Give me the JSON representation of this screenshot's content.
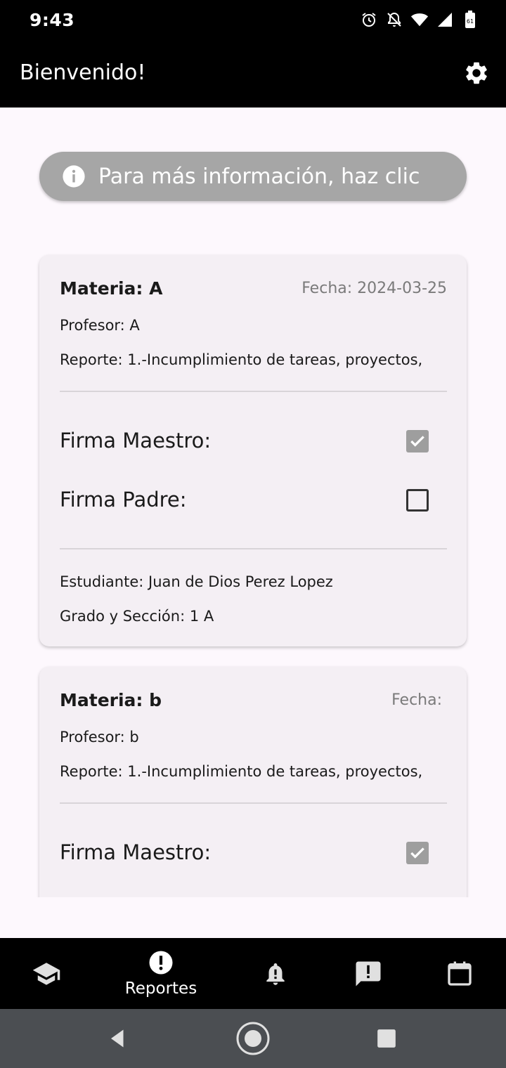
{
  "status_bar": {
    "time": "9:43",
    "icons": [
      "alarm-icon",
      "notifications-off-icon",
      "wifi-icon",
      "signal-icon",
      "battery-icon"
    ]
  },
  "app_bar": {
    "title": "Bienvenido!",
    "settings_icon": "gear-icon"
  },
  "info_banner": {
    "text": "Para más información, haz clic",
    "icon": "info-icon"
  },
  "reports": [
    {
      "subject": "Materia: A",
      "date": "Fecha: 2024-03-25",
      "teacher": "Profesor: A",
      "report": "Reporte: 1.-Incumplimiento de tareas, proyectos,",
      "teacher_signature_label": "Firma Maestro:",
      "teacher_signed": true,
      "parent_signature_label": "Firma Padre:",
      "parent_signed": false,
      "student": "Estudiante: Juan de Dios Perez Lopez",
      "grade": "Grado y Sección: 1 A"
    },
    {
      "subject": "Materia: b",
      "date": "Fecha:",
      "teacher": "Profesor: b",
      "report": "Reporte: 1.-Incumplimiento de tareas, proyectos,",
      "teacher_signature_label": "Firma Maestro:",
      "teacher_signed": true
    }
  ],
  "bottom_nav": {
    "items": [
      {
        "icon": "school-icon",
        "label": ""
      },
      {
        "icon": "report-icon",
        "label": "Reportes",
        "active": true
      },
      {
        "icon": "notification-alert-icon",
        "label": ""
      },
      {
        "icon": "feedback-icon",
        "label": ""
      },
      {
        "icon": "calendar-icon",
        "label": ""
      }
    ]
  },
  "colors": {
    "app_bar": "#000000",
    "background": "#fdf8fd",
    "card": "#f4eff4",
    "banner": "#a6a6a6",
    "checkbox_checked": "#9e9e9e"
  }
}
